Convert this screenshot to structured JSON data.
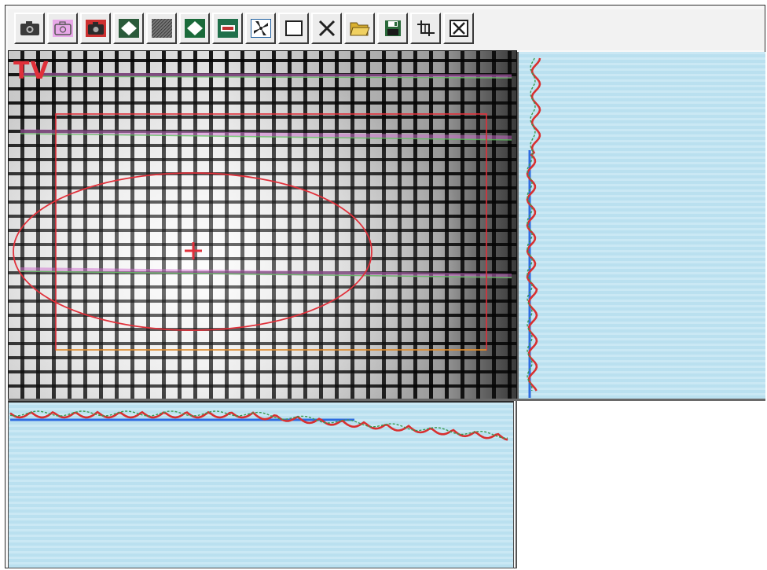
{
  "overlay_label": "TV",
  "toolbar": {
    "buttons": [
      {
        "name": "camera-icon",
        "color": "#3a3a3a"
      },
      {
        "name": "camera-outline-icon",
        "color": "#cc66cc"
      },
      {
        "name": "camera-color-icon",
        "color": "#b03030"
      },
      {
        "name": "diamond-icon",
        "color": "#2a6040"
      },
      {
        "name": "hatch-pattern-icon",
        "color": "#555555"
      },
      {
        "name": "diamond-green-icon",
        "color": "#1a6a3a"
      },
      {
        "name": "minus-box-icon",
        "color": "#c03030"
      },
      {
        "name": "fan-icon",
        "color": "#2060a0"
      },
      {
        "name": "square-outline-icon",
        "color": "#303030"
      },
      {
        "name": "cross-icon",
        "color": "#202020"
      },
      {
        "name": "folder-open-icon",
        "color": "#d0a020"
      },
      {
        "name": "save-disk-icon",
        "color": "#2a6a3a"
      },
      {
        "name": "crop-icon",
        "color": "#202020"
      },
      {
        "name": "close-box-icon",
        "color": "#202020"
      }
    ]
  },
  "colors": {
    "overlay_red": "#e0303a",
    "profile_red": "#d83030",
    "profile_green": "#3a9a50",
    "profile_blue": "#2d6be0",
    "panel_bg": "#bfe3f2"
  }
}
